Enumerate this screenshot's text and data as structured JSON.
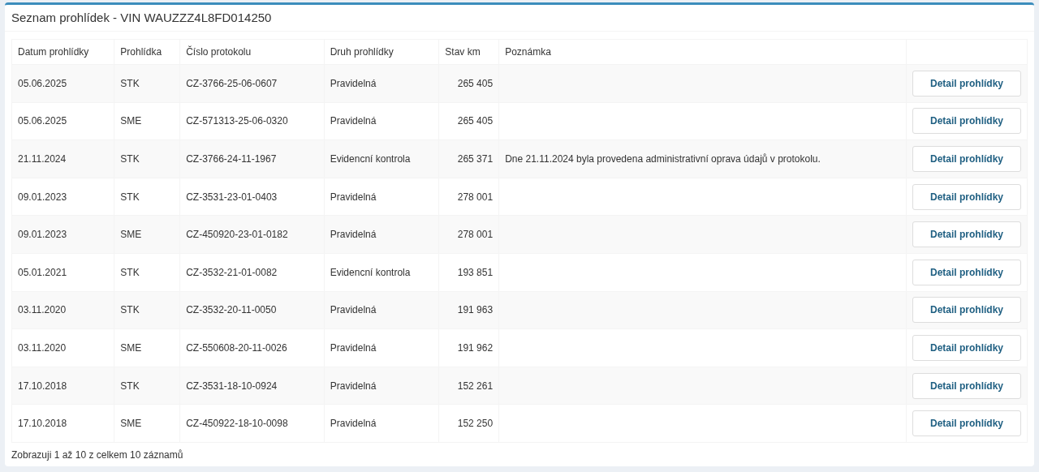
{
  "panel": {
    "title": "Seznam prohlídek - VIN WAUZZZ4L8FD014250"
  },
  "table": {
    "columns": [
      "Datum prohlídky",
      "Prohlídka",
      "Číslo protokolu",
      "Druh prohlídky",
      "Stav km",
      "Poznámka"
    ],
    "rows": [
      {
        "date": "05.06.2025",
        "type": "STK",
        "protocol": "CZ-3766-25-06-0607",
        "kind": "Pravidelná",
        "km": "265 405",
        "note": "",
        "action": "Detail prohlídky"
      },
      {
        "date": "05.06.2025",
        "type": "SME",
        "protocol": "CZ-571313-25-06-0320",
        "kind": "Pravidelná",
        "km": "265 405",
        "note": "",
        "action": "Detail prohlídky"
      },
      {
        "date": "21.11.2024",
        "type": "STK",
        "protocol": "CZ-3766-24-11-1967",
        "kind": "Evidencní kontrola",
        "km": "265 371",
        "note": "Dne 21.11.2024 byla provedena administrativní oprava údajů v protokolu.",
        "action": "Detail prohlídky"
      },
      {
        "date": "09.01.2023",
        "type": "STK",
        "protocol": "CZ-3531-23-01-0403",
        "kind": "Pravidelná",
        "km": "278 001",
        "note": "",
        "action": "Detail prohlídky"
      },
      {
        "date": "09.01.2023",
        "type": "SME",
        "protocol": "CZ-450920-23-01-0182",
        "kind": "Pravidelná",
        "km": "278 001",
        "note": "",
        "action": "Detail prohlídky"
      },
      {
        "date": "05.01.2021",
        "type": "STK",
        "protocol": "CZ-3532-21-01-0082",
        "kind": "Evidencní kontrola",
        "km": "193 851",
        "note": "",
        "action": "Detail prohlídky"
      },
      {
        "date": "03.11.2020",
        "type": "STK",
        "protocol": "CZ-3532-20-11-0050",
        "kind": "Pravidelná",
        "km": "191 963",
        "note": "",
        "action": "Detail prohlídky"
      },
      {
        "date": "03.11.2020",
        "type": "SME",
        "protocol": "CZ-550608-20-11-0026",
        "kind": "Pravidelná",
        "km": "191 962",
        "note": "",
        "action": "Detail prohlídky"
      },
      {
        "date": "17.10.2018",
        "type": "STK",
        "protocol": "CZ-3531-18-10-0924",
        "kind": "Pravidelná",
        "km": "152 261",
        "note": "",
        "action": "Detail prohlídky"
      },
      {
        "date": "17.10.2018",
        "type": "SME",
        "protocol": "CZ-450922-18-10-0098",
        "kind": "Pravidelná",
        "km": "152 250",
        "note": "",
        "action": "Detail prohlídky"
      }
    ]
  },
  "footer": "Zobrazuji 1 až 10 z celkem 10 záznamů"
}
